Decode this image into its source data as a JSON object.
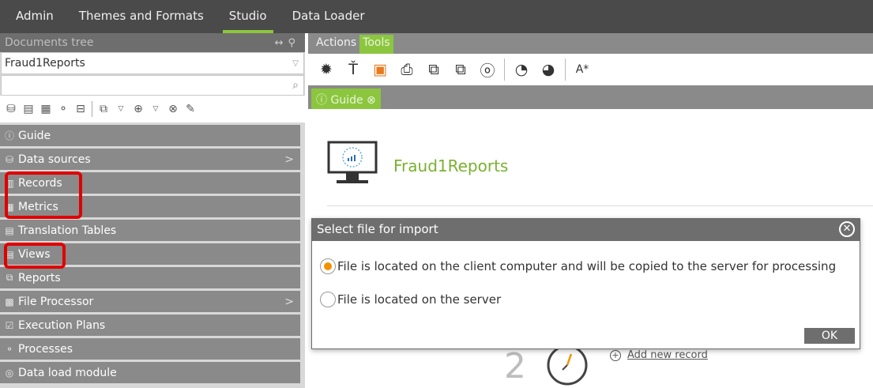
{
  "topnav": {
    "tabs": [
      {
        "label": "Admin"
      },
      {
        "label": "Themes and Formats"
      },
      {
        "label": "Studio"
      },
      {
        "label": "Data Loader"
      }
    ],
    "active_tab": "Studio"
  },
  "leftpanel": {
    "header": "Documents tree",
    "selected_document": "Fraud1Reports",
    "search_placeholder": "",
    "tree_items": [
      {
        "label": "Guide",
        "icon": "info-circle-icon",
        "has_chevron": false
      },
      {
        "label": "Data sources",
        "icon": "database-icon",
        "has_chevron": true
      },
      {
        "label": "Records",
        "icon": "records-icon",
        "has_chevron": false
      },
      {
        "label": "Metrics",
        "icon": "grid-icon",
        "has_chevron": false
      },
      {
        "label": "Translation Tables",
        "icon": "table-icon",
        "has_chevron": false
      },
      {
        "label": "Views",
        "icon": "view-icon",
        "has_chevron": false
      },
      {
        "label": "Reports",
        "icon": "report-icon",
        "has_chevron": false
      },
      {
        "label": "File Processor",
        "icon": "chip-icon",
        "has_chevron": true
      },
      {
        "label": "Execution Plans",
        "icon": "checkbox-icon",
        "has_chevron": false
      },
      {
        "label": "Processes",
        "icon": "process-icon",
        "has_chevron": false
      },
      {
        "label": "Data load module",
        "icon": "module-icon",
        "has_chevron": false
      }
    ]
  },
  "rightarea": {
    "tabs": [
      {
        "label": "Actions"
      },
      {
        "label": "Tools"
      }
    ],
    "active_tab": "Tools",
    "guide_tab": {
      "label": "Guide"
    },
    "document_title": "Fraud1Reports",
    "step_number": "2",
    "add_new_record": "Add new record"
  },
  "dialog": {
    "title": "Select file for import",
    "options": [
      {
        "label": "File is located on the client computer and will be copied to the server for processing",
        "checked": true
      },
      {
        "label": "File is located on the server",
        "checked": false
      }
    ],
    "ok_label": "OK"
  },
  "colors": {
    "accent_green": "#8cc63f",
    "radio_orange": "#f39200",
    "highlight_red": "#e00000",
    "dark_bar": "#4a4a4a"
  }
}
